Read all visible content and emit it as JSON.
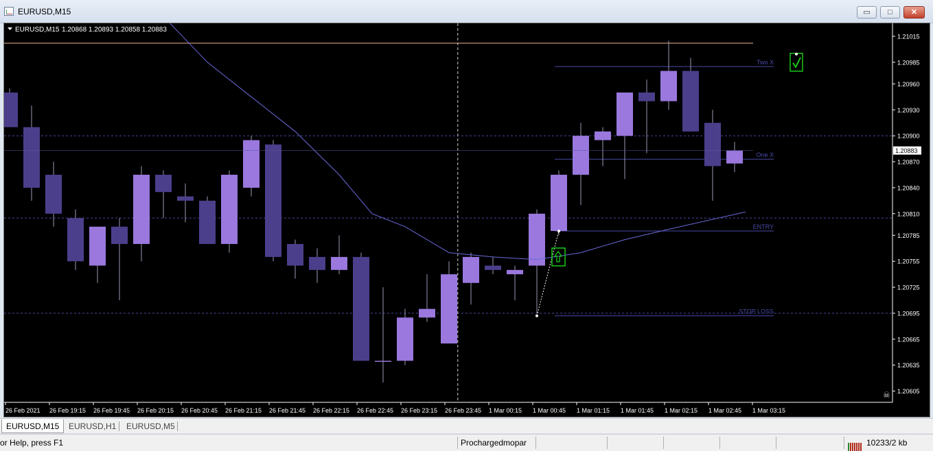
{
  "window": {
    "title": "EURUSD,M15",
    "buttons": {
      "minimize": "▭",
      "maximize": "□",
      "close": "✕"
    }
  },
  "chart_header": {
    "symbol": "EURUSD,M15",
    "ohlc": "1.20868 1.20893 1.20858 1.20883"
  },
  "chart_data": {
    "type": "candlestick",
    "ylim": [
      1.20592,
      1.2103
    ],
    "price_ticks": [
      "1.21015",
      "1.20985",
      "1.20960",
      "1.20930",
      "1.20900",
      "1.20870",
      "1.20840",
      "1.20810",
      "1.20785",
      "1.20755",
      "1.20725",
      "1.20695",
      "1.20665",
      "1.20635",
      "1.20605"
    ],
    "current_price": "1.20883",
    "time_labels": [
      "26 Feb 2021",
      "26 Feb 19:15",
      "26 Feb 19:45",
      "26 Feb 20:15",
      "26 Feb 20:45",
      "26 Feb 21:15",
      "26 Feb 21:45",
      "26 Feb 22:15",
      "26 Feb 22:45",
      "26 Feb 23:15",
      "26 Feb 23:45",
      "1 Mar 00:15",
      "1 Mar 00:45",
      "1 Mar 01:15",
      "1 Mar 01:45",
      "1 Mar 02:15",
      "1 Mar 02:45",
      "1 Mar 03:15"
    ],
    "candles": [
      {
        "o": 1.2095,
        "h": 1.20955,
        "l": 1.2091,
        "c": 1.2091
      },
      {
        "o": 1.2091,
        "h": 1.20935,
        "l": 1.20825,
        "c": 1.2084
      },
      {
        "o": 1.20855,
        "h": 1.2087,
        "l": 1.20795,
        "c": 1.2081
      },
      {
        "o": 1.20805,
        "h": 1.20815,
        "l": 1.20745,
        "c": 1.20755
      },
      {
        "o": 1.2075,
        "h": 1.20795,
        "l": 1.2073,
        "c": 1.20795
      },
      {
        "o": 1.20795,
        "h": 1.20805,
        "l": 1.2071,
        "c": 1.20775
      },
      {
        "o": 1.20775,
        "h": 1.20865,
        "l": 1.20755,
        "c": 1.20855
      },
      {
        "o": 1.20855,
        "h": 1.2086,
        "l": 1.20805,
        "c": 1.20835
      },
      {
        "o": 1.2083,
        "h": 1.20845,
        "l": 1.208,
        "c": 1.20825
      },
      {
        "o": 1.20825,
        "h": 1.2083,
        "l": 1.20775,
        "c": 1.20775
      },
      {
        "o": 1.20775,
        "h": 1.2086,
        "l": 1.20765,
        "c": 1.20855
      },
      {
        "o": 1.2084,
        "h": 1.209,
        "l": 1.2083,
        "c": 1.20895
      },
      {
        "o": 1.2089,
        "h": 1.20895,
        "l": 1.20755,
        "c": 1.2076
      },
      {
        "o": 1.20775,
        "h": 1.2078,
        "l": 1.20735,
        "c": 1.2075
      },
      {
        "o": 1.2076,
        "h": 1.2077,
        "l": 1.2073,
        "c": 1.20745
      },
      {
        "o": 1.20745,
        "h": 1.20785,
        "l": 1.2074,
        "c": 1.2076
      },
      {
        "o": 1.2076,
        "h": 1.20765,
        "l": 1.2064,
        "c": 1.2064
      },
      {
        "o": 1.2064,
        "h": 1.20725,
        "l": 1.20615,
        "c": 1.2064
      },
      {
        "o": 1.2064,
        "h": 1.207,
        "l": 1.20635,
        "c": 1.2069
      },
      {
        "o": 1.2069,
        "h": 1.2074,
        "l": 1.20685,
        "c": 1.207
      },
      {
        "o": 1.2066,
        "h": 1.20755,
        "l": 1.2066,
        "c": 1.2074
      },
      {
        "o": 1.2073,
        "h": 1.20765,
        "l": 1.20705,
        "c": 1.2076
      },
      {
        "o": 1.2075,
        "h": 1.2076,
        "l": 1.2074,
        "c": 1.20745
      },
      {
        "o": 1.2074,
        "h": 1.2075,
        "l": 1.2071,
        "c": 1.20745
      },
      {
        "o": 1.2075,
        "h": 1.20815,
        "l": 1.20695,
        "c": 1.2081
      },
      {
        "o": 1.2079,
        "h": 1.2086,
        "l": 1.20785,
        "c": 1.20855
      },
      {
        "o": 1.20855,
        "h": 1.20915,
        "l": 1.2082,
        "c": 1.209
      },
      {
        "o": 1.20895,
        "h": 1.2091,
        "l": 1.20865,
        "c": 1.20905
      },
      {
        "o": 1.209,
        "h": 1.2095,
        "l": 1.2085,
        "c": 1.2095
      },
      {
        "o": 1.2095,
        "h": 1.20965,
        "l": 1.2088,
        "c": 1.2094
      },
      {
        "o": 1.2094,
        "h": 1.2101,
        "l": 1.2093,
        "c": 1.20975
      },
      {
        "o": 1.20975,
        "h": 1.2099,
        "l": 1.20905,
        "c": 1.20905
      },
      {
        "o": 1.20915,
        "h": 1.2093,
        "l": 1.20825,
        "c": 1.20865
      },
      {
        "o": 1.20868,
        "h": 1.20893,
        "l": 1.20858,
        "c": 1.20883
      }
    ],
    "moving_average": [
      {
        "i": 7.3,
        "v": 1.2103
      },
      {
        "i": 9.0,
        "v": 1.20985
      },
      {
        "i": 11.0,
        "v": 1.20945
      },
      {
        "i": 13.0,
        "v": 1.20905
      },
      {
        "i": 15.0,
        "v": 1.20855
      },
      {
        "i": 16.5,
        "v": 1.2081
      },
      {
        "i": 18.0,
        "v": 1.20795
      },
      {
        "i": 20.0,
        "v": 1.20765
      },
      {
        "i": 22.0,
        "v": 1.2076
      },
      {
        "i": 24.0,
        "v": 1.20757
      },
      {
        "i": 26.0,
        "v": 1.20765
      },
      {
        "i": 28.0,
        "v": 1.2078
      },
      {
        "i": 30.0,
        "v": 1.20792
      },
      {
        "i": 33.5,
        "v": 1.20812
      }
    ],
    "horizontal_lines": [
      {
        "price": 1.21007,
        "color": "#f0b890",
        "style": "solid"
      },
      {
        "price": 1.209,
        "color": "#4848a0",
        "style": "dashed"
      },
      {
        "price": 1.20805,
        "color": "#4848a0",
        "style": "dashed"
      },
      {
        "price": 1.20695,
        "color": "#4848a0",
        "style": "dashed"
      }
    ],
    "trade_levels": [
      {
        "label": "Two X",
        "price": 1.2098
      },
      {
        "label": "One X",
        "price": 1.20873
      },
      {
        "label": "ENTRY",
        "price": 1.2079
      },
      {
        "label": "STOP LOSS",
        "price": 1.20692
      }
    ],
    "crosshair_time_index": 20.4,
    "grid": false
  },
  "tabs": [
    "EURUSD,M15",
    "EURUSD,H1",
    "EURUSD,M5"
  ],
  "status": {
    "help_text": "or Help, press F1",
    "profile": "Prochargedmopar",
    "traffic": "10233/2 kb"
  },
  "colors": {
    "bull": "#9a78de",
    "bear": "#4b3f8c",
    "wick": "#9a9ab8",
    "ma": "#6a6adc",
    "level": "#4a4aa8",
    "marker": "#1ac81a",
    "axis_text": "#ffffff"
  }
}
